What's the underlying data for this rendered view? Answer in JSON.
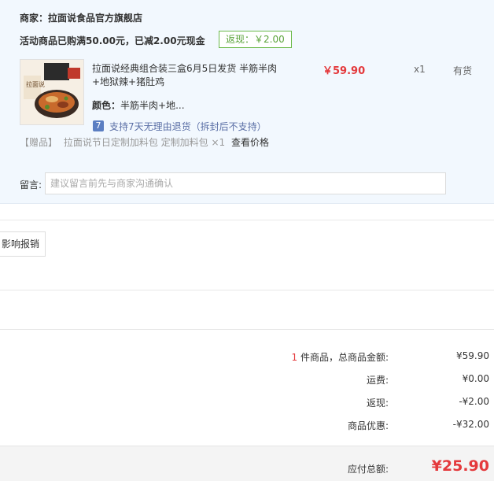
{
  "shop": {
    "merchant_label": "商家：",
    "merchant_name": "拉面说食品官方旗舰店",
    "promo_text": "活动商品已购满50.00元，已减2.00元现金",
    "rebate_badge": "返现：￥2.00"
  },
  "item": {
    "title_line1": "拉面说经典组合装三盒6月5日发货 半筋半肉",
    "title_line2": "+地狱辣+猪肚鸡",
    "color_label": "颜色：",
    "color_value": "半筋半肉+地...",
    "price": "￥59.90",
    "quantity": "x1",
    "stock": "有货",
    "return_icon_glyph": "7",
    "return_policy": "支持7天无理由退货（拆封后不支持）",
    "thumb_text": "拉面说"
  },
  "gift": {
    "tag": "【赠品】",
    "text": "拉面说节日定制加料包 定制加料包 ×1",
    "link": "查看价格"
  },
  "memo": {
    "label": "留言:",
    "placeholder": "建议留言前先与商家沟通确认"
  },
  "invoice": {
    "button_label": "影响报销"
  },
  "summary": {
    "count": "1",
    "count_suffix": " 件商品，总商品金额:",
    "goods_amount": "¥59.90",
    "shipping_label": "运费:",
    "shipping_value": "¥0.00",
    "cashback_label": "返现:",
    "cashback_value": "-¥2.00",
    "discount_label": "商品优惠:",
    "discount_value": "-¥32.00"
  },
  "total": {
    "label": "应付总额:",
    "amount": "¥25.90"
  },
  "colors": {
    "accent_red": "#e4393c",
    "panel_bg": "#f2f8fe",
    "badge_green": "#5aa33a"
  }
}
